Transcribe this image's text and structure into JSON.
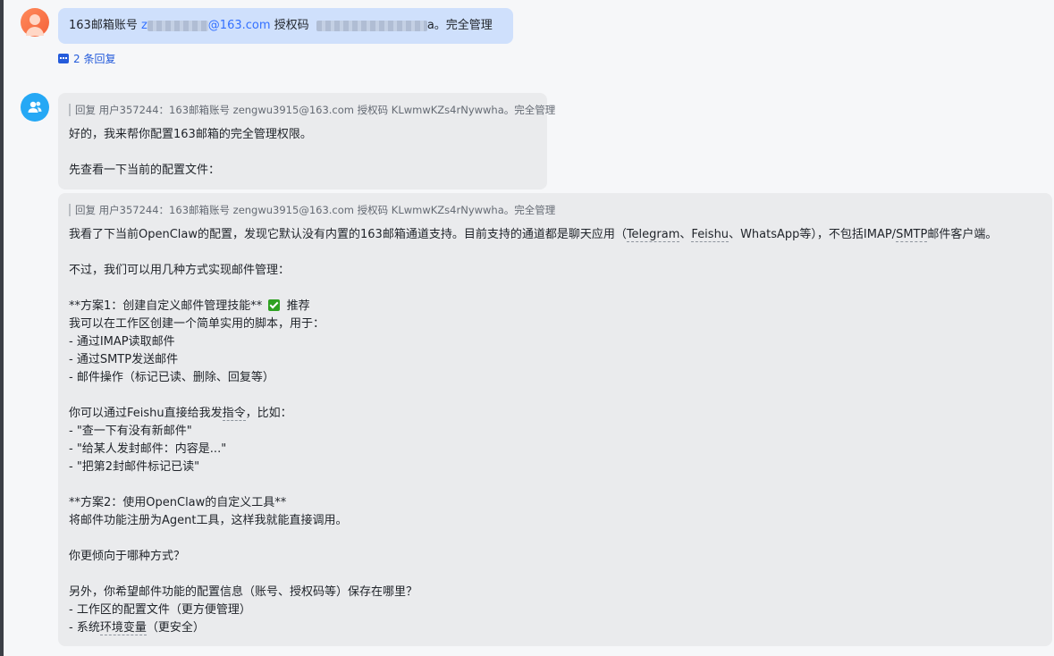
{
  "user_message": {
    "prefix": "163邮箱账号",
    "email_start": "z",
    "email_suffix": "@163.com",
    "auth_label": "授权码",
    "auth_tail": "a",
    "suffix": "。完全管理"
  },
  "reply_count": "2 条回复",
  "bot_message_1": {
    "quote": "回复 用户357244：163邮箱账号 zengwu3915@163.com 授权码 KLwmwKZs4rNywwha。完全管理",
    "lines": [
      "好的，我来帮你配置163邮箱的完全管理权限。",
      "",
      "先查看一下当前的配置文件："
    ]
  },
  "bot_message_2": {
    "quote": "回复 用户357244：163邮箱账号 zengwu3915@163.com 授权码 KLwmwKZs4rNywwha。完全管理",
    "line1_parts": [
      "我看了下当前OpenClaw的配置，发现它默认没有内置的163邮箱通道支持。目前支持的通道都是聊天应用（",
      "Telegram",
      "、",
      "Feishu",
      "、WhatsApp等），不包括IMAP/",
      "SMTP",
      "邮件客户端。"
    ],
    "line_a": [
      "",
      "不过，我们可以用几种方式实现邮件管理：",
      ""
    ],
    "plan1_title": "**方案1：创建自定义邮件管理技能**",
    "plan1_badge": "推荐",
    "line_b": [
      "我可以在工作区创建一个简单实用的脚本，用于：",
      "- 通过IMAP读取邮件",
      "- 通过SMTP发送邮件",
      "- 邮件操作（标记已读、删除、回复等）",
      ""
    ],
    "feishu_parts": [
      "你可以通过Feishu直接给我发",
      "指令",
      "，比如："
    ],
    "line_c": [
      "- \"查一下有没有新邮件\"",
      "- \"给某人发封邮件：内容是...\"",
      "- \"把第2封邮件标记已读\"",
      "",
      "**方案2：使用OpenClaw的自定义工具**",
      "将邮件功能注册为Agent工具，这样我就能直接调用。",
      "",
      "你更倾向于哪种方式？",
      "",
      "另外，你希望邮件功能的配置信息（账号、授权码等）保存在哪里？",
      "- 工作区的配置文件（更方便管理）"
    ],
    "last_parts": [
      "- 系统",
      "环境变量",
      "（更安全）"
    ]
  },
  "colors": {
    "user_bubble": "#cfe0fc",
    "bot_bubble": "#eaebed",
    "link": "#245bdb",
    "check": "#2ea121"
  }
}
